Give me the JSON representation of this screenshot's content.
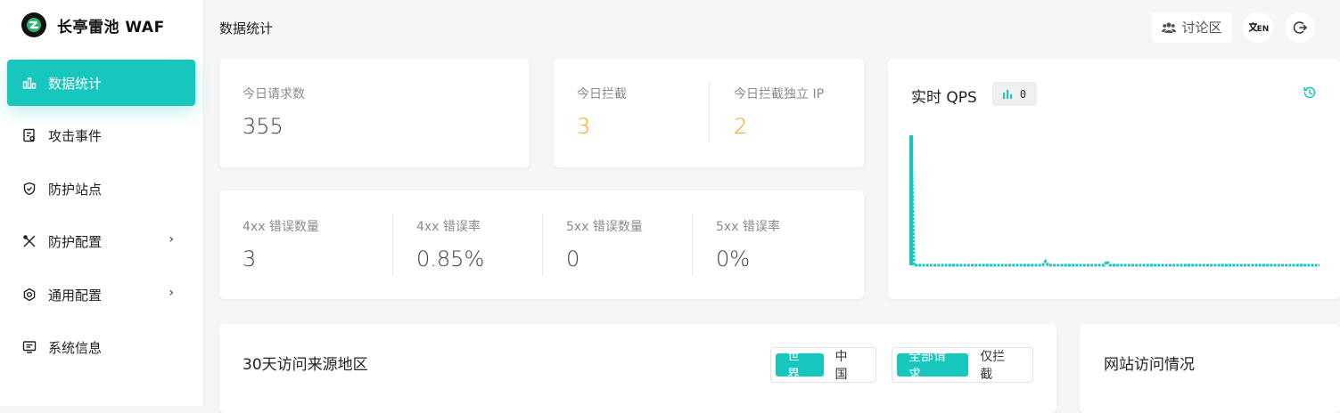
{
  "app": {
    "name": "长亭雷池 WAF"
  },
  "sidebar": {
    "items": [
      {
        "label": "数据统计",
        "icon": "bar-chart-icon",
        "active": true
      },
      {
        "label": "攻击事件",
        "icon": "event-icon"
      },
      {
        "label": "防护站点",
        "icon": "shield-icon"
      },
      {
        "label": "防护配置",
        "icon": "tools-icon",
        "arrow": "›"
      },
      {
        "label": "通用配置",
        "icon": "gear-icon",
        "arrow": "›"
      },
      {
        "label": "系统信息",
        "icon": "monitor-icon"
      }
    ]
  },
  "header": {
    "title": "数据统计",
    "forum_label": "讨论区",
    "lang_label": "EN"
  },
  "today": {
    "requests_label": "今日请求数",
    "requests_value": "355",
    "blocked_label": "今日拦截",
    "blocked_value": "3",
    "blocked_ip_label": "今日拦截独立 IP",
    "blocked_ip_value": "2"
  },
  "errors": {
    "e4_count_label": "4xx 错误数量",
    "e4_count_value": "3",
    "e4_rate_label": "4xx 错误率",
    "e4_rate_value": "0.85%",
    "e5_count_label": "5xx 错误数量",
    "e5_count_value": "0",
    "e5_rate_label": "5xx 错误率",
    "e5_rate_value": "0%"
  },
  "qps": {
    "title": "实时 QPS",
    "current": "0",
    "accent": "#17c6bd",
    "series": [
      10,
      0,
      0,
      0,
      0,
      0,
      0,
      0,
      0,
      0,
      0,
      0,
      0,
      0,
      0,
      0,
      0,
      0,
      0,
      0,
      0,
      0,
      0,
      0,
      0,
      0,
      0,
      0,
      0,
      0,
      0,
      0,
      0,
      0,
      0,
      0,
      0,
      0,
      0,
      0,
      0,
      0,
      0,
      0,
      0,
      0,
      0,
      0,
      0.3,
      0,
      0,
      0,
      0,
      0,
      0,
      0,
      0,
      0,
      0,
      0,
      0,
      0,
      0,
      0,
      0,
      0,
      0,
      0,
      0,
      0,
      0.3,
      0,
      0,
      0,
      0,
      0,
      0,
      0,
      0,
      0,
      0,
      0,
      0,
      0,
      0,
      0,
      0,
      0,
      0,
      0,
      0,
      0,
      0,
      0,
      0,
      0,
      0,
      0,
      0,
      0,
      0,
      0,
      0,
      0,
      0,
      0,
      0,
      0,
      0,
      0,
      0,
      0,
      0,
      0,
      0,
      0,
      0,
      0,
      0,
      0,
      0,
      0,
      0,
      0,
      0,
      0,
      0,
      0,
      0,
      0,
      0,
      0,
      0,
      0,
      0,
      0,
      0,
      0,
      0,
      0,
      0,
      0,
      0,
      0,
      0,
      0,
      0
    ]
  },
  "geo": {
    "title": "30天访问来源地区",
    "scope": [
      "世界",
      "中国"
    ],
    "filter": [
      "全部请求",
      "仅拦截"
    ]
  },
  "site": {
    "title": "网站访问情况"
  }
}
